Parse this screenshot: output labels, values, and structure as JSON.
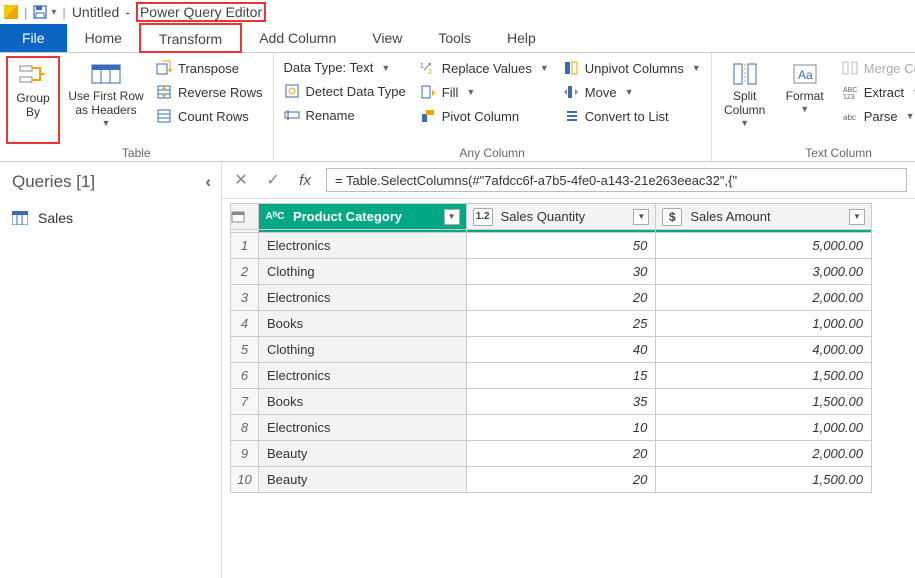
{
  "titlebar": {
    "doc": "Untitled",
    "sep": "-",
    "app": "Power Query Editor",
    "qat_caret": "▾"
  },
  "tabs": {
    "file": "File",
    "home": "Home",
    "transform": "Transform",
    "add_column": "Add Column",
    "view": "View",
    "tools": "Tools",
    "help": "Help"
  },
  "ribbon": {
    "table": {
      "group_by": "Group\nBy",
      "use_first_row": "Use First Row\nas Headers",
      "transpose": "Transpose",
      "reverse_rows": "Reverse Rows",
      "count_rows": "Count Rows",
      "label": "Table"
    },
    "any_column": {
      "data_type": "Data Type: Text",
      "detect": "Detect Data Type",
      "rename": "Rename",
      "replace": "Replace Values",
      "fill": "Fill",
      "pivot": "Pivot Column",
      "unpivot": "Unpivot Columns",
      "move": "Move",
      "convert": "Convert to List",
      "label": "Any Column"
    },
    "text_column": {
      "split": "Split\nColumn",
      "format": "Format",
      "merge": "Merge Columns",
      "extract": "Extract",
      "parse": "Parse",
      "label": "Text Column"
    }
  },
  "queries": {
    "header": "Queries [1]",
    "items": [
      {
        "name": "Sales"
      }
    ]
  },
  "formula": {
    "fx": "fx",
    "value": "= Table.SelectColumns(#\"7afdcc6f-a7b5-4fe0-a143-21e263eeac32\",{\""
  },
  "grid": {
    "columns": [
      {
        "type_label": "AᴮC",
        "name": "Product Category",
        "selected": true
      },
      {
        "type_label": "1.2",
        "name": "Sales Quantity",
        "selected": false
      },
      {
        "type_label": "$",
        "name": "Sales Amount",
        "selected": false
      }
    ],
    "rows": [
      {
        "n": "1",
        "cat": "Electronics",
        "qty": "50",
        "amt": "5,000.00"
      },
      {
        "n": "2",
        "cat": "Clothing",
        "qty": "30",
        "amt": "3,000.00"
      },
      {
        "n": "3",
        "cat": "Electronics",
        "qty": "20",
        "amt": "2,000.00"
      },
      {
        "n": "4",
        "cat": "Books",
        "qty": "25",
        "amt": "1,000.00"
      },
      {
        "n": "5",
        "cat": "Clothing",
        "qty": "40",
        "amt": "4,000.00"
      },
      {
        "n": "6",
        "cat": "Electronics",
        "qty": "15",
        "amt": "1,500.00"
      },
      {
        "n": "7",
        "cat": "Books",
        "qty": "35",
        "amt": "1,500.00"
      },
      {
        "n": "8",
        "cat": "Electronics",
        "qty": "10",
        "amt": "1,000.00"
      },
      {
        "n": "9",
        "cat": "Beauty",
        "qty": "20",
        "amt": "2,000.00"
      },
      {
        "n": "10",
        "cat": "Beauty",
        "qty": "20",
        "amt": "1,500.00"
      }
    ]
  }
}
